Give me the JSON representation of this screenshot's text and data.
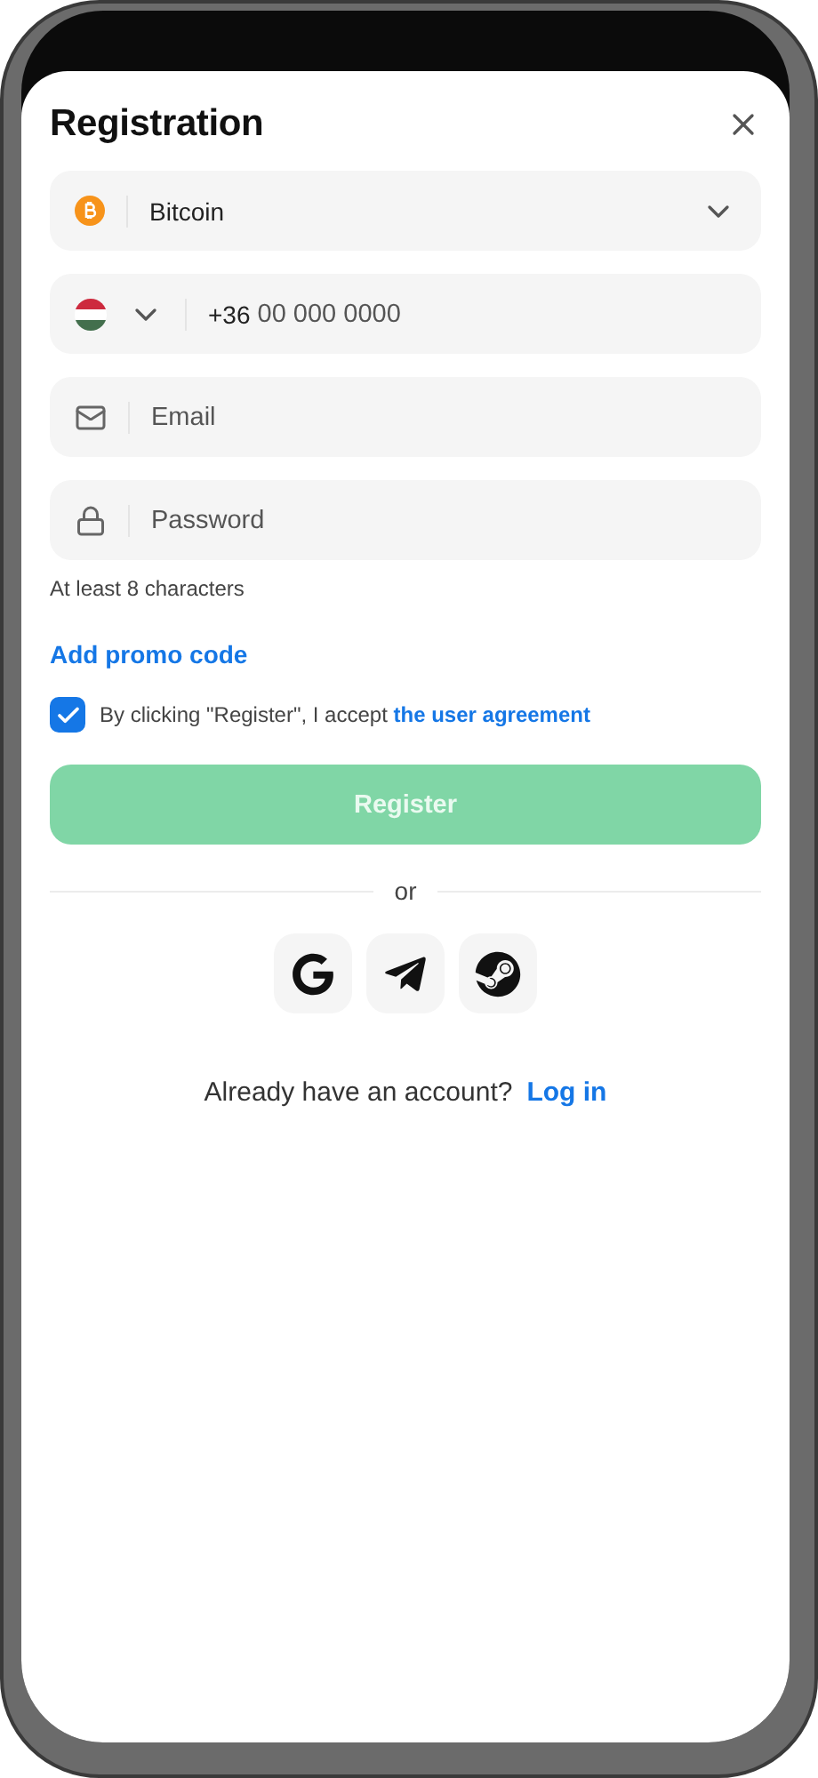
{
  "title": "Registration",
  "currency": {
    "value": "Bitcoin"
  },
  "phone": {
    "prefix": "+36",
    "placeholder": "00 000 0000"
  },
  "email": {
    "placeholder": "Email"
  },
  "password": {
    "placeholder": "Password",
    "hint": "At least 8 characters"
  },
  "promo_link": "Add promo code",
  "agreement": {
    "checked": true,
    "text": "By clicking \"Register\", I accept",
    "link": "the user agreement"
  },
  "register_button": {
    "label": "Register",
    "disabled": true
  },
  "divider_text": "or",
  "social_buttons": [
    {
      "kind": "google"
    },
    {
      "kind": "telegram"
    },
    {
      "kind": "steam"
    }
  ],
  "login_prompt": {
    "text": "Already have an account?",
    "link": "Log in"
  }
}
